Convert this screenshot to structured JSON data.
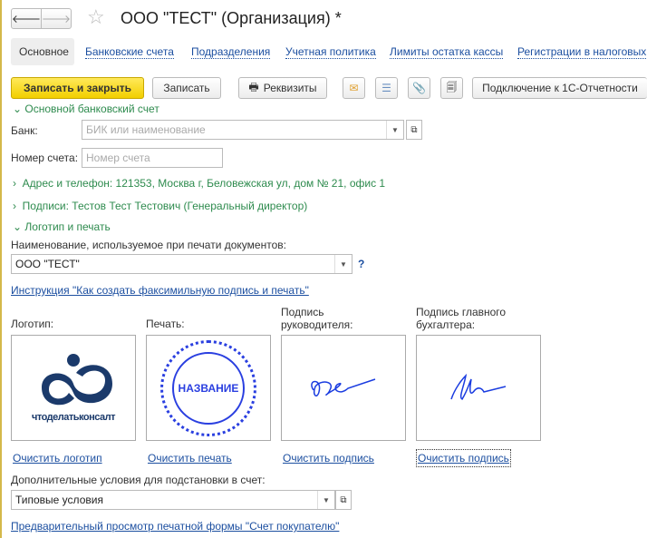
{
  "window": {
    "title": "ООО \"ТЕСТ\" (Организация) *"
  },
  "tabs": [
    {
      "label": "Основное",
      "active": true
    },
    {
      "label": "Банковские счета"
    },
    {
      "label": "Подразделения"
    },
    {
      "label": "Учетная политика"
    },
    {
      "label": "Лимиты остатка кассы"
    },
    {
      "label": "Регистрации в налоговых"
    }
  ],
  "toolbar": {
    "save_close": "Записать и закрыть",
    "save": "Записать",
    "details": "Реквизиты",
    "connect": "Подключение к 1С-Отчетности"
  },
  "bank_group": {
    "title": "Основной банковский счет",
    "bank_label": "Банк:",
    "bank_placeholder": "БИК или наименование",
    "account_label": "Номер счета:",
    "account_placeholder": "Номер счета"
  },
  "address": "Адрес и телефон: 121353, Москва г, Беловежская ул, дом № 21, офис 1",
  "signatures": "Подписи: Тестов Тест Тестович (Генеральный директор)",
  "logo_group": {
    "title": "Логотип и печать",
    "name_label": "Наименование, используемое при печати документов:",
    "name_value": "ООО \"ТЕСТ\"",
    "help": "?",
    "instruction": "Инструкция \"Как создать факсимильную подпись и печать\""
  },
  "images": [
    {
      "label": "Логотип:",
      "clear": "Очистить логотип",
      "logo_text": "чтоделатьконсалт"
    },
    {
      "label": "Печать:",
      "clear": "Очистить печать",
      "stamp_text": "НАЗВАНИЕ"
    },
    {
      "label": "Подпись руководителя:",
      "clear": "Очистить подпись"
    },
    {
      "label": "Подпись главного бухгалтера:",
      "clear": "Очистить подпись"
    }
  ],
  "conditions": {
    "label": "Дополнительные условия для подстановки в счет:",
    "value": "Типовые условия",
    "preview": "Предварительный просмотр печатной формы \"Счет покупателю\""
  }
}
